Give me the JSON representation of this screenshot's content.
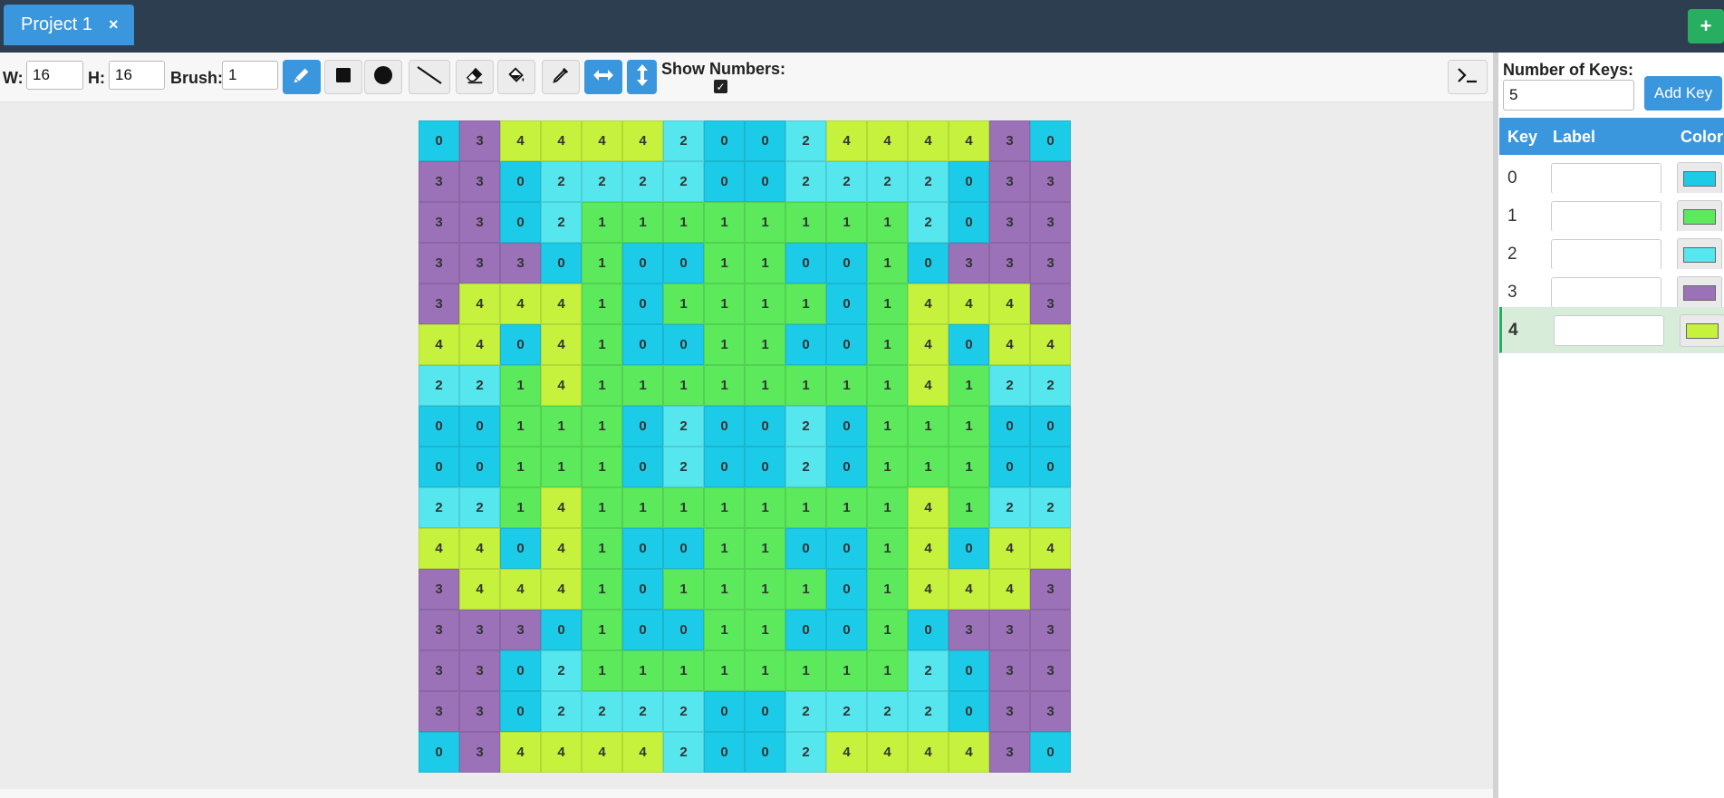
{
  "tabs": [
    {
      "label": "Project 1",
      "close": "×"
    }
  ],
  "add_tab_label": "+",
  "toolbar": {
    "width_label": "W:",
    "width_value": "16",
    "height_label": "H:",
    "height_value": "16",
    "brush_label": "Brush:",
    "brush_value": "1",
    "tools": [
      {
        "name": "pencil-tool",
        "icon": "pencil-icon",
        "active": true
      },
      {
        "name": "rectangle-tool",
        "icon": "square-icon",
        "active": false
      },
      {
        "name": "circle-tool",
        "icon": "circle-icon",
        "active": false
      },
      {
        "name": "line-tool",
        "icon": "line-icon",
        "active": false
      },
      {
        "name": "eraser-tool",
        "icon": "eraser-icon",
        "active": false
      },
      {
        "name": "fill-tool",
        "icon": "paint-bucket-icon",
        "active": false
      },
      {
        "name": "eyedropper-tool",
        "icon": "eyedropper-icon",
        "active": false
      },
      {
        "name": "mirror-horizontal-toggle",
        "icon": "horizontal-arrows-icon",
        "active": true
      },
      {
        "name": "mirror-vertical-toggle",
        "icon": "vertical-arrows-icon",
        "active": true
      }
    ],
    "show_numbers_label": "Show Numbers:",
    "show_numbers_checked": true,
    "console_icon": "terminal-icon"
  },
  "grid": [
    [
      0,
      3,
      4,
      4,
      4,
      4,
      2,
      0,
      0,
      2,
      4,
      4,
      4,
      4,
      3,
      0
    ],
    [
      3,
      3,
      0,
      2,
      2,
      2,
      2,
      0,
      0,
      2,
      2,
      2,
      2,
      0,
      3,
      3
    ],
    [
      3,
      3,
      0,
      2,
      1,
      1,
      1,
      1,
      1,
      1,
      1,
      1,
      2,
      0,
      3,
      3
    ],
    [
      3,
      3,
      3,
      0,
      1,
      0,
      0,
      1,
      1,
      0,
      0,
      1,
      0,
      3,
      3,
      3
    ],
    [
      3,
      4,
      4,
      4,
      1,
      0,
      1,
      1,
      1,
      1,
      0,
      1,
      4,
      4,
      4,
      3
    ],
    [
      4,
      4,
      0,
      4,
      1,
      0,
      0,
      1,
      1,
      0,
      0,
      1,
      4,
      0,
      4,
      4
    ],
    [
      2,
      2,
      1,
      4,
      1,
      1,
      1,
      1,
      1,
      1,
      1,
      1,
      4,
      1,
      2,
      2
    ],
    [
      0,
      0,
      1,
      1,
      1,
      0,
      2,
      0,
      0,
      2,
      0,
      1,
      1,
      1,
      0,
      0
    ],
    [
      0,
      0,
      1,
      1,
      1,
      0,
      2,
      0,
      0,
      2,
      0,
      1,
      1,
      1,
      0,
      0
    ],
    [
      2,
      2,
      1,
      4,
      1,
      1,
      1,
      1,
      1,
      1,
      1,
      1,
      4,
      1,
      2,
      2
    ],
    [
      4,
      4,
      0,
      4,
      1,
      0,
      0,
      1,
      1,
      0,
      0,
      1,
      4,
      0,
      4,
      4
    ],
    [
      3,
      4,
      4,
      4,
      1,
      0,
      1,
      1,
      1,
      1,
      0,
      1,
      4,
      4,
      4,
      3
    ],
    [
      3,
      3,
      3,
      0,
      1,
      0,
      0,
      1,
      1,
      0,
      0,
      1,
      0,
      3,
      3,
      3
    ],
    [
      3,
      3,
      0,
      2,
      1,
      1,
      1,
      1,
      1,
      1,
      1,
      1,
      2,
      0,
      3,
      3
    ],
    [
      3,
      3,
      0,
      2,
      2,
      2,
      2,
      0,
      0,
      2,
      2,
      2,
      2,
      0,
      3,
      3
    ],
    [
      0,
      3,
      4,
      4,
      4,
      4,
      2,
      0,
      0,
      2,
      4,
      4,
      4,
      4,
      3,
      0
    ]
  ],
  "panel": {
    "num_keys_label": "Number of Keys:",
    "num_keys_value": "5",
    "add_key_label": "Add Key",
    "headers": {
      "key": "Key",
      "label": "Label",
      "color": "Color"
    },
    "keys": [
      {
        "key": "0",
        "label": "",
        "color": "#1ccbe8"
      },
      {
        "key": "1",
        "label": "",
        "color": "#5ce95c"
      },
      {
        "key": "2",
        "label": "",
        "color": "#55e6ee"
      },
      {
        "key": "3",
        "label": "",
        "color": "#9b72b8"
      },
      {
        "key": "4",
        "label": "",
        "color": "#c6f23e"
      }
    ],
    "selected_key": "4"
  }
}
